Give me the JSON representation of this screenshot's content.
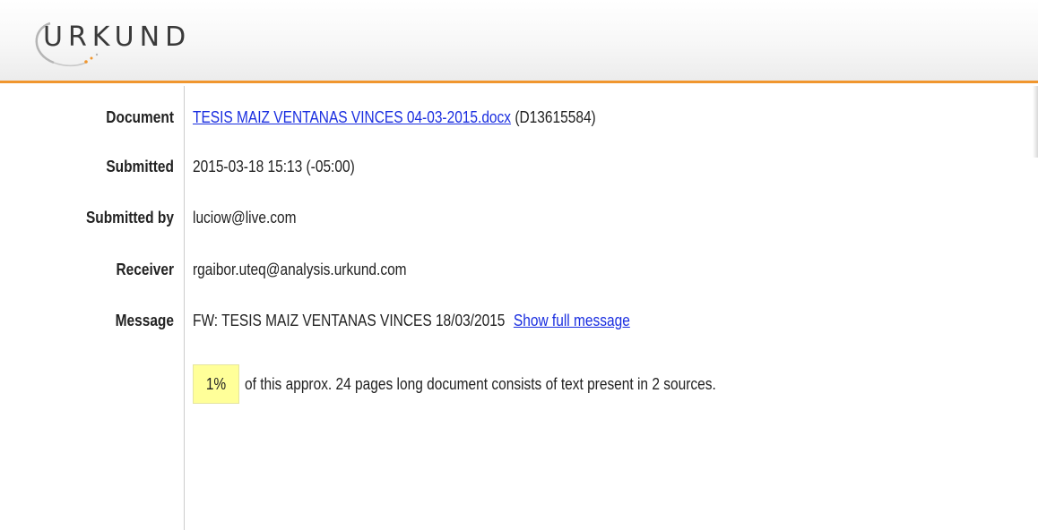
{
  "app": {
    "logo_text": "URKUND",
    "accent_color": "#f0962e"
  },
  "details": {
    "document": {
      "label": "Document",
      "link_text": "TESIS MAIZ VENTANAS VINCES 04-03-2015.docx",
      "suffix": "(D13615584)"
    },
    "submitted": {
      "label": "Submitted",
      "value": "2015-03-18 15:13 (-05:00)"
    },
    "submitted_by": {
      "label": "Submitted by",
      "value": "luciow@live.com"
    },
    "receiver": {
      "label": "Receiver",
      "value": "rgaibor.uteq@analysis.urkund.com"
    },
    "message": {
      "label": "Message",
      "value": "FW: TESIS MAIZ VENTANAS VINCES 18/03/2015",
      "link_text": "Show full message"
    }
  },
  "summary": {
    "percent": "1%",
    "text": "of this approx. 24 pages long document consists of text present in 2 sources.",
    "highlight_color": "#ffff99"
  }
}
